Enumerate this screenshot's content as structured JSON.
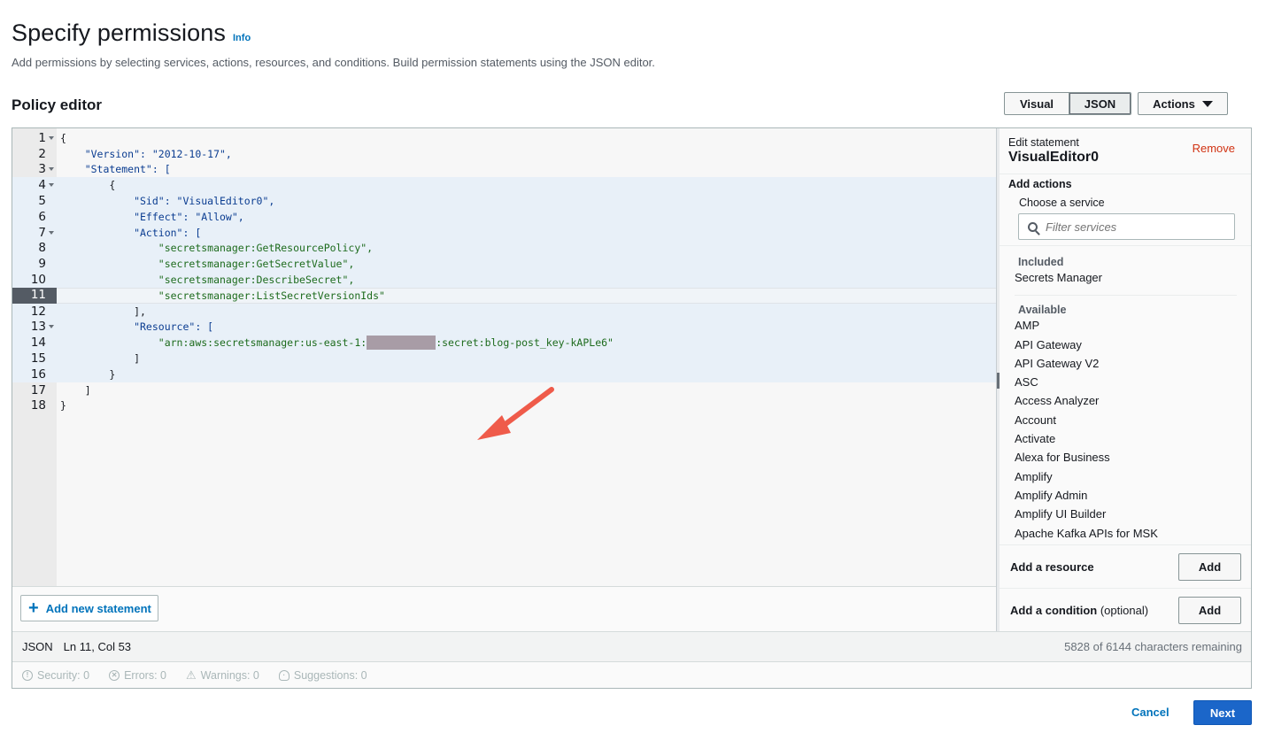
{
  "header": {
    "title": "Specify permissions",
    "info_label": "Info",
    "description": "Add permissions by selecting services, actions, resources, and conditions. Build permission statements using the JSON editor."
  },
  "policy_editor": {
    "title": "Policy editor",
    "modes": {
      "visual": "Visual",
      "json": "JSON",
      "selected": "JSON"
    },
    "actions_label": "Actions"
  },
  "code": {
    "active_line": 11,
    "lines": [
      {
        "n": "1",
        "text": "{"
      },
      {
        "n": "2",
        "text": "    \"Version\": \"2012-10-17\","
      },
      {
        "n": "3",
        "text": "    \"Statement\": ["
      },
      {
        "n": "4",
        "text": "        {"
      },
      {
        "n": "5",
        "text": "            \"Sid\": \"VisualEditor0\","
      },
      {
        "n": "6",
        "text": "            \"Effect\": \"Allow\","
      },
      {
        "n": "7",
        "text": "            \"Action\": ["
      },
      {
        "n": "8",
        "text": "                \"secretsmanager:GetResourcePolicy\","
      },
      {
        "n": "9",
        "text": "                \"secretsmanager:GetSecretValue\","
      },
      {
        "n": "10",
        "text": "                \"secretsmanager:DescribeSecret\","
      },
      {
        "n": "11",
        "text": "                \"secretsmanager:ListSecretVersionIds\""
      },
      {
        "n": "12",
        "text": "            ],"
      },
      {
        "n": "13",
        "text": "            \"Resource\": ["
      },
      {
        "n": "14a",
        "text": "                \"arn:aws:secretsmanager:us-east-1:"
      },
      {
        "n": "14b",
        "text": ":secret:blog-post_key-kAPLe6\""
      },
      {
        "n": "15",
        "text": "            ]"
      },
      {
        "n": "16",
        "text": "        }"
      },
      {
        "n": "17",
        "text": "    ]"
      },
      {
        "n": "18",
        "text": "}"
      }
    ]
  },
  "statement_bar": {
    "add_label": "Add new statement"
  },
  "side_panel": {
    "edit_label": "Edit statement",
    "statement_name": "VisualEditor0",
    "remove_label": "Remove",
    "add_actions_label": "Add actions",
    "choose_service_label": "Choose a service",
    "filter_placeholder": "Filter services",
    "included_title": "Included",
    "included": [
      "Secrets Manager"
    ],
    "available_title": "Available",
    "available": [
      "AMP",
      "API Gateway",
      "API Gateway V2",
      "ASC",
      "Access Analyzer",
      "Account",
      "Activate",
      "Alexa for Business",
      "Amplify",
      "Amplify Admin",
      "Amplify UI Builder",
      "Apache Kafka APIs for MSK"
    ],
    "add_resource_label": "Add a resource",
    "add_condition_label": "Add a condition",
    "optional_label": "(optional)",
    "add_button_label": "Add"
  },
  "status": {
    "mode": "JSON",
    "position": "Ln 11, Col 53",
    "remaining": "5828 of 6144 characters remaining"
  },
  "issues": {
    "security": "Security: 0",
    "errors": "Errors: 0",
    "warnings": "Warnings: 0",
    "suggestions": "Suggestions: 0"
  },
  "footer": {
    "cancel_label": "Cancel",
    "next_label": "Next"
  },
  "colors": {
    "accent": "#0073bb",
    "primary_button": "#1b66c9",
    "danger": "#d13212",
    "arrow": "#ef5b4a"
  }
}
